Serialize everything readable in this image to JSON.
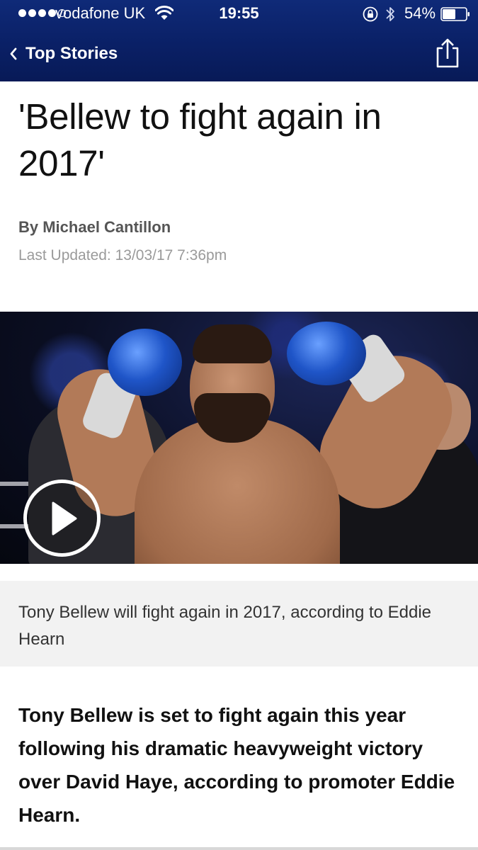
{
  "status_bar": {
    "carrier": "vodafone UK",
    "time": "19:55",
    "battery_percent": "54%",
    "signal_bars": 4,
    "signal_total": 5,
    "icons": [
      "signal-dots-icon",
      "wifi-icon",
      "rotation-lock-icon",
      "bluetooth-icon",
      "battery-icon"
    ]
  },
  "nav": {
    "back_label": "Top Stories",
    "back_icon": "chevron-left-icon",
    "share_icon": "share-icon"
  },
  "article": {
    "headline": "'Bellew to fight again in 2017'",
    "byline": "By Michael Cantillon",
    "last_updated": "Last Updated: 13/03/17 7:36pm",
    "image": {
      "subject": "boxer-celebrating-photo",
      "play_icon": "play-icon"
    },
    "caption": "Tony Bellew will fight again in 2017, according to Eddie Hearn",
    "lead": "Tony Bellew is set to fight again this year following his dramatic heavyweight victory over David Haye, according to promoter Eddie Hearn."
  },
  "colors": {
    "header_bg": "#0a2066",
    "caption_bg": "#f2f2f2",
    "byline_text": "#555555",
    "timestamp_text": "#9a9a9a"
  }
}
